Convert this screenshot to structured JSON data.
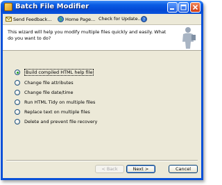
{
  "window": {
    "title": "Batch File Modifier"
  },
  "toolbar": {
    "send_feedback": "Send Feedback...",
    "home_page": "Home Page...",
    "check_update": "Check for Update..."
  },
  "header": {
    "text": "This wizard will help you modify multiple files quickly and easily.  What do you want to do?"
  },
  "options": [
    {
      "label": "Build compiled HTML help file",
      "checked": true
    },
    {
      "label": "Change file attributes",
      "checked": false
    },
    {
      "label": "Change file date/time",
      "checked": false
    },
    {
      "label": "Run HTML Tidy on multiple files",
      "checked": false
    },
    {
      "label": "Replace text on multiple files",
      "checked": false
    },
    {
      "label": "Delete and prevent file recovery",
      "checked": false
    }
  ],
  "buttons": {
    "back": "< Back",
    "next": "Next >",
    "cancel": "Cancel"
  },
  "colors": {
    "titlebar": "#0a5ce5",
    "dialog_bg": "#ece9d8",
    "close_button": "#d03a14",
    "radio_dot": "#21a121"
  }
}
